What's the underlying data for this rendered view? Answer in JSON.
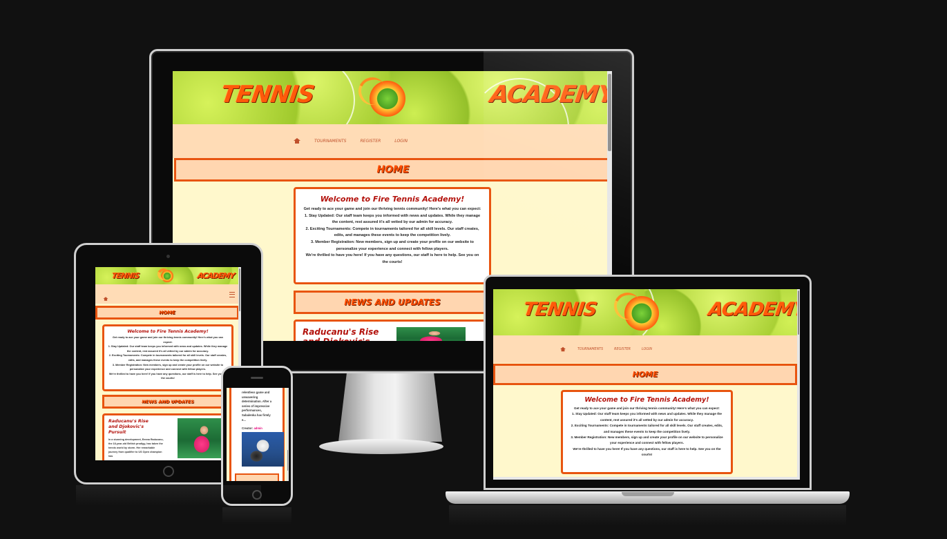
{
  "site": {
    "brand_left": "TENNIS",
    "brand_right": "ACADEMY",
    "nav": {
      "home_icon": "home-icon",
      "tournaments": "TOURNAMENTS",
      "register": "REGISTER",
      "login": "LOGIN",
      "menu_icon": "hamburger-menu-icon"
    },
    "home_heading": "HOME",
    "welcome": {
      "title": "Welcome to Fire Tennis Academy!",
      "intro": "Get ready to ace your game and join our thriving tennis community! Here's what you can expect:",
      "item1": "1. Stay Updated: Our staff team keeps you informed with news and updates. While they manage the content, rest assured it's all vetted by our admin for accuracy.",
      "item2": "2. Exciting Tournaments: Compete in tournaments tailored for all skill levels. Our staff creates, edits, and manages these events to keep the competition lively.",
      "item3": "3. Member Registration: New members, sign up and create your profile on our website to personalize your experience and connect with fellow players.",
      "outro": "We're thrilled to have you here! If you have any questions, our staff is here to help. See you on the courts!"
    },
    "news_heading": "NEWS AND UPDATES",
    "news1": {
      "title": "Raducanu's Rise and Djokovic's Pursuit",
      "excerpt": "In a stunning development, Emma Raducanu, the 18-year-old British prodigy, has taken the tennis world by storm. Her remarkable journey from qualifier to US Open champion has"
    },
    "news2": {
      "excerpt": "relentless game and unwavering determination. After a series of impressive performances, Sabalenka has firmly e...",
      "creator_label": "Creator:",
      "creator_name": "admin"
    }
  },
  "colors": {
    "page_background": "#111111",
    "accent_orange": "#e8540f",
    "nav_background": "#ffdcb6",
    "content_background": "#fff8cc",
    "title_red": "#b3120c"
  }
}
